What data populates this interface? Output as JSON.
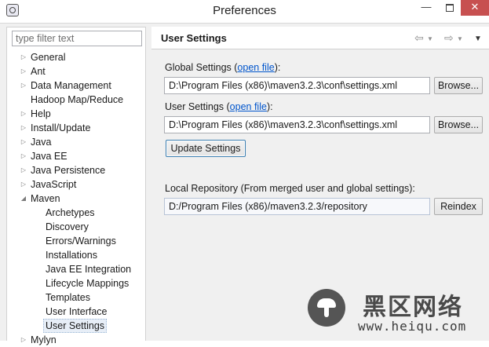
{
  "window": {
    "title": "Preferences",
    "minimize_glyph": "—",
    "close_glyph": "✕"
  },
  "filter": {
    "placeholder": "type filter text"
  },
  "tree": [
    {
      "label": "General",
      "expander": "▷",
      "child": false
    },
    {
      "label": "Ant",
      "expander": "▷",
      "child": false
    },
    {
      "label": "Data Management",
      "expander": "▷",
      "child": false
    },
    {
      "label": "Hadoop Map/Reduce",
      "expander": "",
      "child": false
    },
    {
      "label": "Help",
      "expander": "▷",
      "child": false
    },
    {
      "label": "Install/Update",
      "expander": "▷",
      "child": false
    },
    {
      "label": "Java",
      "expander": "▷",
      "child": false
    },
    {
      "label": "Java EE",
      "expander": "▷",
      "child": false
    },
    {
      "label": "Java Persistence",
      "expander": "▷",
      "child": false
    },
    {
      "label": "JavaScript",
      "expander": "▷",
      "child": false
    },
    {
      "label": "Maven",
      "expander": "◢",
      "child": false
    },
    {
      "label": "Archetypes",
      "expander": "",
      "child": true
    },
    {
      "label": "Discovery",
      "expander": "",
      "child": true
    },
    {
      "label": "Errors/Warnings",
      "expander": "",
      "child": true
    },
    {
      "label": "Installations",
      "expander": "",
      "child": true
    },
    {
      "label": "Java EE Integration",
      "expander": "",
      "child": true
    },
    {
      "label": "Lifecycle Mappings",
      "expander": "",
      "child": true
    },
    {
      "label": "Templates",
      "expander": "",
      "child": true
    },
    {
      "label": "User Interface",
      "expander": "",
      "child": true
    },
    {
      "label": "User Settings",
      "expander": "",
      "child": true,
      "selected": true
    },
    {
      "label": "Mylyn",
      "expander": "▷",
      "child": false
    }
  ],
  "page": {
    "title": "User Settings",
    "nav_back": "⇦",
    "nav_forward": "⇨",
    "dropdown": "▼",
    "global": {
      "label_prefix": "Global Settings (",
      "link": "open file",
      "label_suffix": "):",
      "value": "D:\\Program Files (x86)\\maven3.2.3\\conf\\settings.xml",
      "browse": "Browse..."
    },
    "user": {
      "label_prefix": "User Settings (",
      "link": "open file",
      "label_suffix": "):",
      "value": "D:\\Program Files (x86)\\maven3.2.3\\conf\\settings.xml",
      "browse": "Browse..."
    },
    "update_button": "Update Settings",
    "local_repo": {
      "label": "Local Repository (From merged user and global settings):",
      "value": "D:/Program Files (x86)/maven3.2.3/repository",
      "reindex": "Reindex"
    }
  },
  "watermark": {
    "cn": "黑区网络",
    "url": "www.heiqu.com"
  }
}
